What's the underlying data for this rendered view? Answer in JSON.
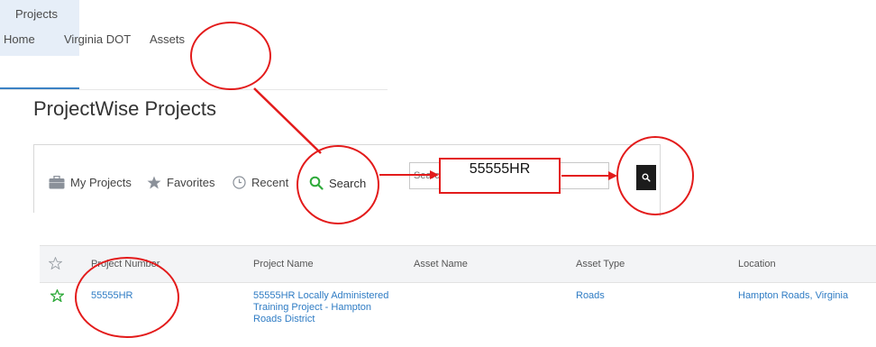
{
  "nav": {
    "items": [
      {
        "label": "Home"
      },
      {
        "label": "Virginia DOT"
      },
      {
        "label": "Assets"
      },
      {
        "label": "Projects"
      }
    ]
  },
  "page": {
    "title": "ProjectWise Projects"
  },
  "toolbar": {
    "my_projects": "My Projects",
    "favorites": "Favorites",
    "recent": "Recent",
    "search": "Search",
    "search_placeholder": "Search",
    "search_button_icon": "search-icon"
  },
  "annotation": {
    "callout_text": "55555HR",
    "accent_color": "#e31b1b"
  },
  "table": {
    "columns": [
      "Project Number",
      "Project Name",
      "Asset Name",
      "Asset Type",
      "Location"
    ],
    "rows": [
      {
        "favorite_icon": "star-outline-icon",
        "project_number": "55555HR",
        "project_name": "55555HR Locally Administered Training Project - Hampton Roads District",
        "asset_name": "",
        "asset_type": "Roads",
        "location": "Hampton Roads, Virginia"
      }
    ]
  }
}
